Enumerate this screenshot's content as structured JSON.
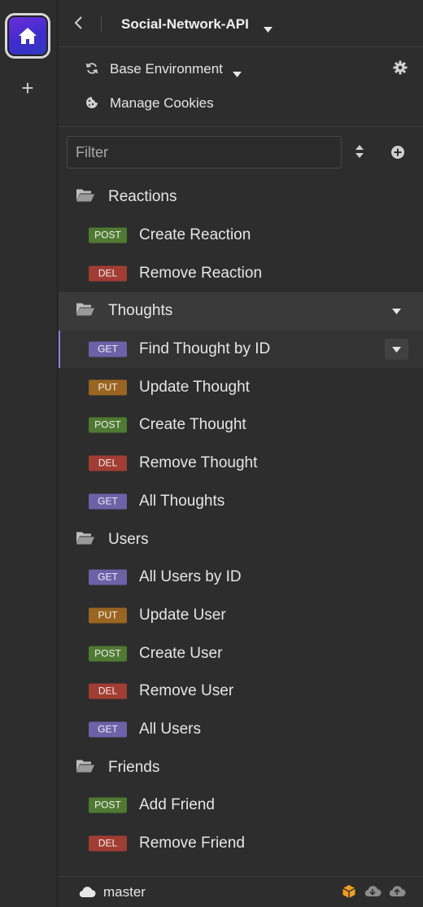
{
  "project": {
    "title": "Social-Network-API"
  },
  "environment": {
    "label": "Base Environment"
  },
  "cookies": {
    "label": "Manage Cookies"
  },
  "filter": {
    "placeholder": "Filter",
    "value": ""
  },
  "method_colors": {
    "GET": "#6d62a8",
    "POST": "#4e7a32",
    "PUT": "#9a6520",
    "DEL": "#a23d33"
  },
  "tree": [
    {
      "kind": "folder",
      "name": "Reactions"
    },
    {
      "kind": "request",
      "method": "POST",
      "name": "Create Reaction"
    },
    {
      "kind": "request",
      "method": "DEL",
      "name": "Remove Reaction"
    },
    {
      "kind": "folder",
      "name": "Thoughts",
      "active": true
    },
    {
      "kind": "request",
      "method": "GET",
      "name": "Find Thought by ID",
      "active": true
    },
    {
      "kind": "request",
      "method": "PUT",
      "name": "Update Thought"
    },
    {
      "kind": "request",
      "method": "POST",
      "name": "Create Thought"
    },
    {
      "kind": "request",
      "method": "DEL",
      "name": "Remove Thought"
    },
    {
      "kind": "request",
      "method": "GET",
      "name": "All Thoughts"
    },
    {
      "kind": "folder",
      "name": "Users"
    },
    {
      "kind": "request",
      "method": "GET",
      "name": "All Users by ID"
    },
    {
      "kind": "request",
      "method": "PUT",
      "name": "Update User"
    },
    {
      "kind": "request",
      "method": "POST",
      "name": "Create User"
    },
    {
      "kind": "request",
      "method": "DEL",
      "name": "Remove User"
    },
    {
      "kind": "request",
      "method": "GET",
      "name": "All Users"
    },
    {
      "kind": "folder",
      "name": "Friends"
    },
    {
      "kind": "request",
      "method": "POST",
      "name": "Add Friend"
    },
    {
      "kind": "request",
      "method": "DEL",
      "name": "Remove Friend"
    }
  ],
  "footer": {
    "branch": "master"
  }
}
